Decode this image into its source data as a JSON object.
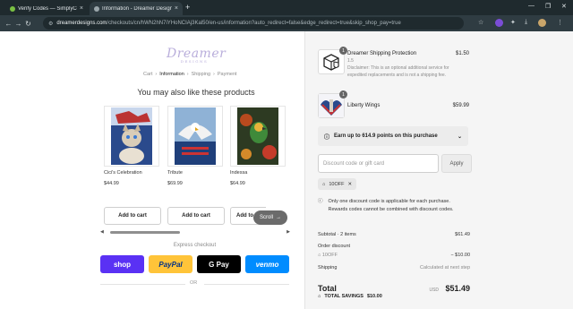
{
  "browser": {
    "tabs": [
      {
        "title": "Verify Codes — SimplyCodes",
        "favicon_color": "#7ac143",
        "active": false
      },
      {
        "title": "Information - Dreamer Designs",
        "favicon_color": "#9aa6ab",
        "active": true
      }
    ],
    "url_host": "dreamerdesigns.com",
    "url_path": "/checkouts/cn/hWN2hN7iYHoNCIAj3Kal50/en-us/information?auto_redirect=false&edge_redirect=true&skip_shop_pay=true",
    "new_tab": "+",
    "close_tab": "×",
    "icons": [
      "back-arrow-icon",
      "forward-arrow-icon",
      "reload-icon",
      "site-info-icon",
      "star-icon",
      "extension-icon",
      "puzzle-icon",
      "download-icon",
      "profile-icon",
      "menu-icon"
    ]
  },
  "store": {
    "logo_text": "Dreamer",
    "logo_sub": "DESIGNS",
    "breadcrumb": [
      "Cart",
      "Information",
      "Shipping",
      "Payment"
    ],
    "breadcrumb_current": "Information",
    "upsell_title": "You may also like these products",
    "products": [
      {
        "name": "Cici's Celebration",
        "price": "$44.99",
        "button": "Add to cart"
      },
      {
        "name": "Tribute",
        "price": "$69.99",
        "button": "Add to cart"
      },
      {
        "name": "Indessa",
        "price": "$64.99",
        "button": "Add to cart"
      }
    ],
    "scroll_label": "Scroll",
    "express_checkout": "Express checkout",
    "pay_buttons": [
      {
        "label": "shop",
        "bg": "#5a31f4",
        "fg": "#ffffff"
      },
      {
        "label": "PayPal",
        "bg": "#ffc439",
        "fg": "#003087"
      },
      {
        "label": "G Pay",
        "bg": "#000000",
        "fg": "#ffffff"
      },
      {
        "label": "venmo",
        "bg": "#008cff",
        "fg": "#ffffff"
      }
    ],
    "or_label": "OR"
  },
  "summary": {
    "items": [
      {
        "name": "Dreamer Shipping Protection",
        "sub": "1.5",
        "description": "Disclaimer: This is an optional additional service for expedited replacements and is not a shipping fee.",
        "price": "$1.50",
        "qty": "1"
      },
      {
        "name": "Liberty Wings",
        "price": "$59.99",
        "qty": "1"
      }
    ],
    "points_text": "Earn up to 614.9 points on this purchase",
    "discount_placeholder": "Discount code or gift card",
    "apply_label": "Apply",
    "applied_code": "10OFF",
    "notice": "Only one discount code is applicable for each purchase. Rewards codes cannot be combined with discount codes.",
    "subtotal_label": "Subtotal · 2 items",
    "subtotal_value": "$61.49",
    "order_discount_label": "Order discount",
    "order_discount_code": "10OFF",
    "order_discount_value": "− $10.00",
    "shipping_label": "Shipping",
    "shipping_value": "Calculated at next step",
    "total_label": "Total",
    "currency": "USD",
    "total_value": "$51.49",
    "savings_label": "TOTAL SAVINGS",
    "savings_value": "$10.00"
  }
}
